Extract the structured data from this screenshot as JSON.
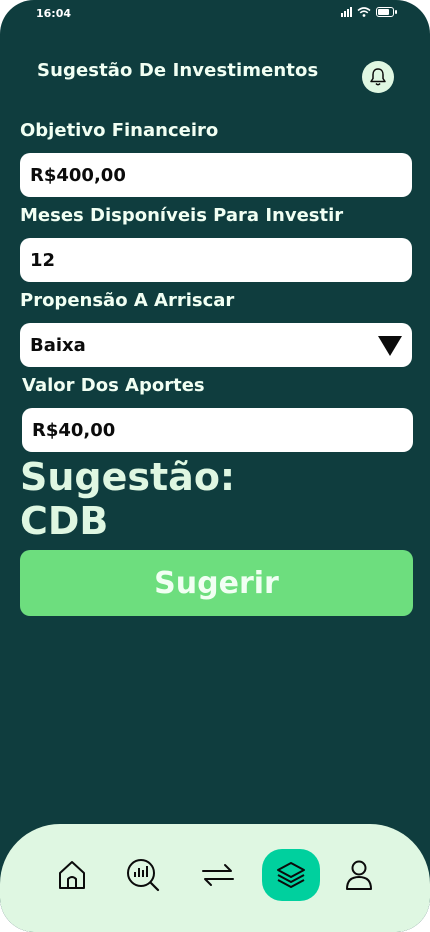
{
  "status": {
    "time": "16:04"
  },
  "header": {
    "title": "Sugestão De Investimentos",
    "notification_icon": "bell-icon"
  },
  "form": {
    "goal_label": "Objetivo Financeiro",
    "goal_value": "R$400,00",
    "months_label": "Meses Disponíveis Para Investir",
    "months_value": "12",
    "risk_label": "Propensão A Arriscar",
    "risk_value": "Baixa",
    "contribution_label": "Valor Dos Aportes",
    "contribution_value": "R$40,00"
  },
  "result": {
    "label": "Sugestão:",
    "value": "CDB"
  },
  "submit": {
    "label": "Sugerir"
  },
  "nav": {
    "items": [
      {
        "icon": "home-icon"
      },
      {
        "icon": "analysis-icon"
      },
      {
        "icon": "transfer-icon"
      },
      {
        "icon": "layers-icon",
        "active": true
      },
      {
        "icon": "profile-icon"
      }
    ]
  },
  "colors": {
    "background": "#0f3d3e",
    "accent": "#00d09e",
    "button": "#6dde7e",
    "navbar": "#dff7e2"
  }
}
